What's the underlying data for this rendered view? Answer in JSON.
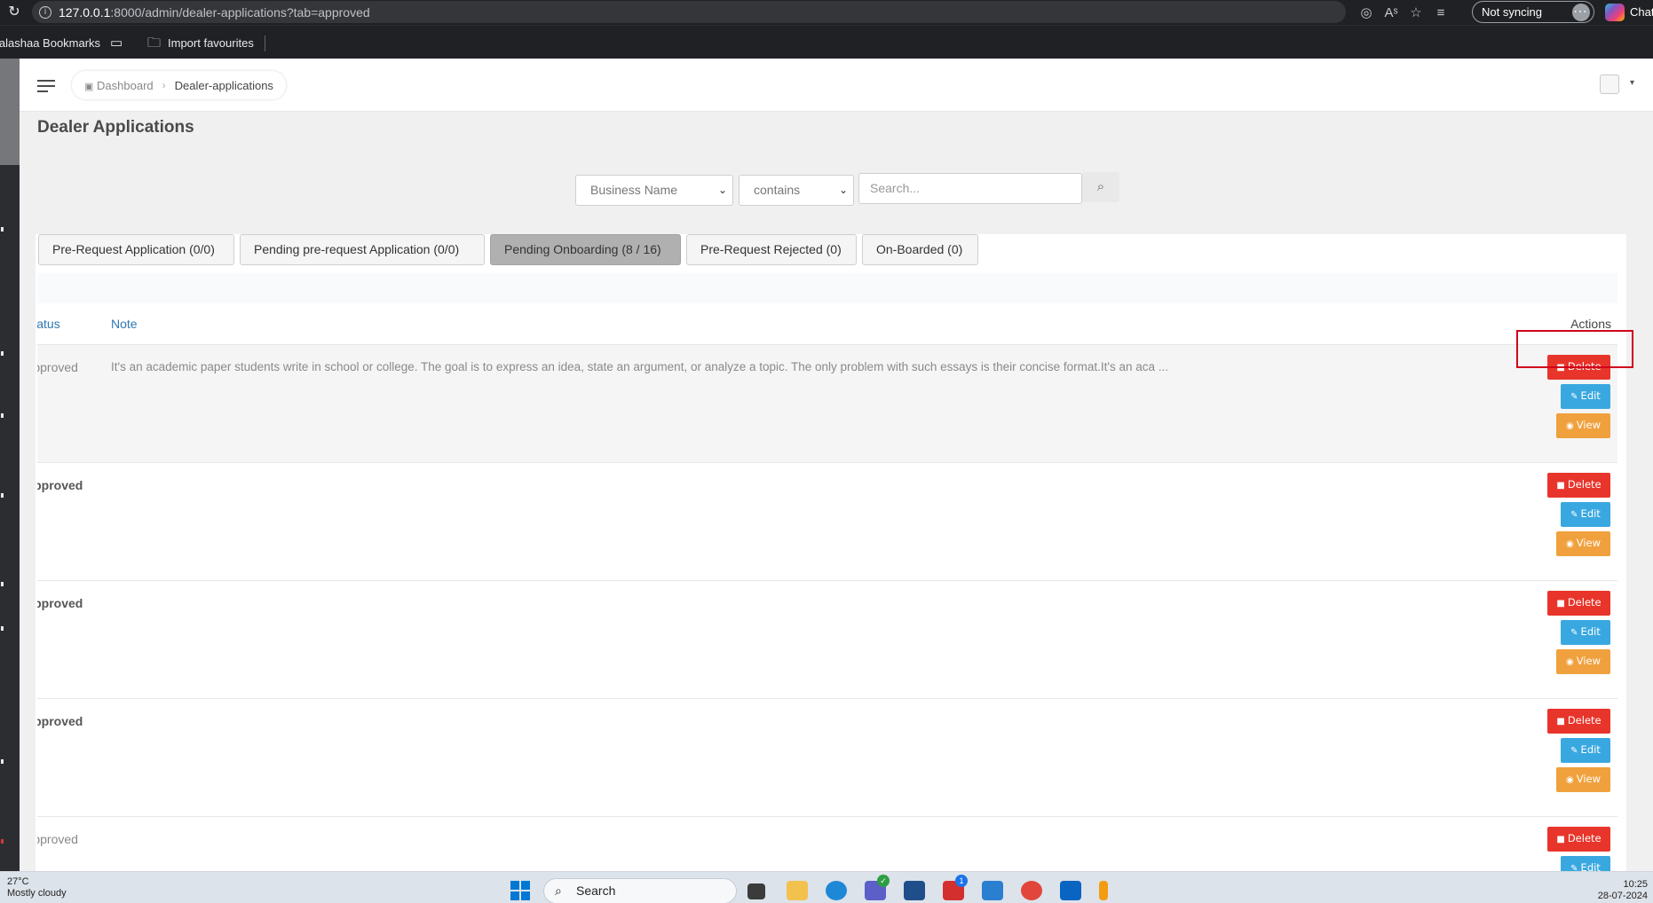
{
  "browser": {
    "url_host": "127.0.0.1",
    "url_rest": ":8000/admin/dealer-applications?tab=approved",
    "sync_label": "Not syncing",
    "chat_label": "Chat"
  },
  "bookmarks": {
    "folder_label": "lalashaa Bookmarks",
    "import_label": "Import favourites"
  },
  "topbar": {
    "breadcrumb_home": "Dashboard",
    "breadcrumb_current": "Dealer-applications"
  },
  "page": {
    "title": "Dealer Applications"
  },
  "filters": {
    "field_select": "Business Name",
    "operator_select": "contains",
    "search_placeholder": "Search..."
  },
  "tabs": [
    {
      "label": "Pre-Request Application (0/0)",
      "active": false
    },
    {
      "label": "Pending pre-request Application (0/0)",
      "active": false
    },
    {
      "label": "Pending Onboarding (8 / 16)",
      "active": true
    },
    {
      "label": "Pre-Request Rejected (0)",
      "active": false
    },
    {
      "label": "On-Boarded (0)",
      "active": false
    }
  ],
  "table": {
    "headers": {
      "status": "Status",
      "note": "Note",
      "actions": "Actions"
    },
    "rows": [
      {
        "status": "Approved",
        "note": "It's an academic paper students write in school or college. The goal is to express an idea, state an argument, or analyze a topic. The only problem with such essays is their concise format.It's an aca ..."
      },
      {
        "status": "Approved",
        "note": ""
      },
      {
        "status": "Approved",
        "note": ""
      },
      {
        "status": "Approved",
        "note": ""
      },
      {
        "status": "Approved",
        "note": ""
      }
    ],
    "action_labels": {
      "delete": "Delete",
      "edit": "Edit",
      "view": "View"
    }
  },
  "taskbar": {
    "temperature": "27°C",
    "weather": "Mostly cloudy",
    "search_label": "Search",
    "time": "10:25",
    "date": "28-07-2024",
    "badge_count": "1"
  },
  "colors": {
    "delete": "#e8352b",
    "edit": "#3aa8e0",
    "view": "#f0a13d",
    "highlight": "#d0021b",
    "link": "#2f78b4"
  }
}
